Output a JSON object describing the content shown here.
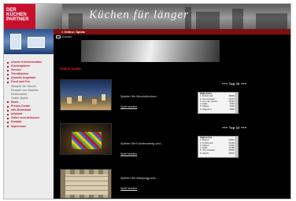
{
  "header": {
    "logo_line1": "DER",
    "logo_line2": "KÜCHEN",
    "logo_line3": "PARTNER",
    "tagline": "Küchen für länger"
  },
  "sidebar": {
    "nav": [
      {
        "label": "Unsere Küchenstudios",
        "type": "main"
      },
      {
        "label": "Küchenplaner",
        "type": "main"
      },
      {
        "label": "Service",
        "type": "main"
      },
      {
        "label": "Trendküchen",
        "type": "main"
      },
      {
        "label": "Aktuelle Angebote",
        "type": "main"
      },
      {
        "label": "Fund und Fun",
        "type": "main"
      },
      {
        "label": "Rezepte der Woche",
        "type": "sub"
      },
      {
        "label": "Rezepte von Stephan",
        "type": "sub"
      },
      {
        "label": "Küchenwitze",
        "type": "sub"
      },
      {
        "label": "Online-Spiele",
        "type": "sub"
      },
      {
        "label": "News",
        "type": "main"
      },
      {
        "label": "Presse-Center",
        "type": "main"
      },
      {
        "label": "Info-Download",
        "type": "main"
      },
      {
        "label": "Infobrief",
        "type": "main"
      },
      {
        "label": "Zeiten zum Anfassen",
        "type": "main"
      },
      {
        "label": "Kontakt",
        "type": "main"
      },
      {
        "label": "Impressum",
        "type": "main"
      }
    ]
  },
  "content": {
    "mail_label": "Kontakt",
    "breadcrumb": "» Online: Spiele",
    "section_title": "Online-Spiele",
    "games": [
      {
        "description": "Spielen Sie Moorhühnchen...",
        "link": "Spiel starten"
      },
      {
        "description": "Spielen Sie Küchenzwerg und...",
        "link": "Spiel starten"
      },
      {
        "description": "Spielen Sie Mahjongg und...",
        "link": "Spiel starten"
      }
    ],
    "top10_title": "+++ Top 10 +++",
    "scores1": {
      "header": "Highscores",
      "rows": [
        {
          "name": "1. M.Schmidt",
          "score": "15800"
        },
        {
          "name": "2. Otto Hamber",
          "score": "12275"
        },
        {
          "name": "3. Tom der GerFix",
          "score": "11310"
        },
        {
          "name": "4. Kalle",
          "score": "9710"
        },
        {
          "name": "5. Flipper",
          "score": "9120"
        },
        {
          "name": "6. Dagobert",
          "score": "8930"
        }
      ]
    },
    "scores2": {
      "header": "Highscores",
      "rows": [
        {
          "name": "1. Rupert",
          "score": "14810"
        },
        {
          "name": "2. M.Schmidt",
          "score": "13190"
        },
        {
          "name": "3. Flipper",
          "score": "12110"
        },
        {
          "name": "4. Kalle",
          "score": "11380"
        },
        {
          "name": "5. Otto Hamber",
          "score": "10930"
        },
        {
          "name": "6. Henrik",
          "score": "10570"
        }
      ]
    }
  }
}
